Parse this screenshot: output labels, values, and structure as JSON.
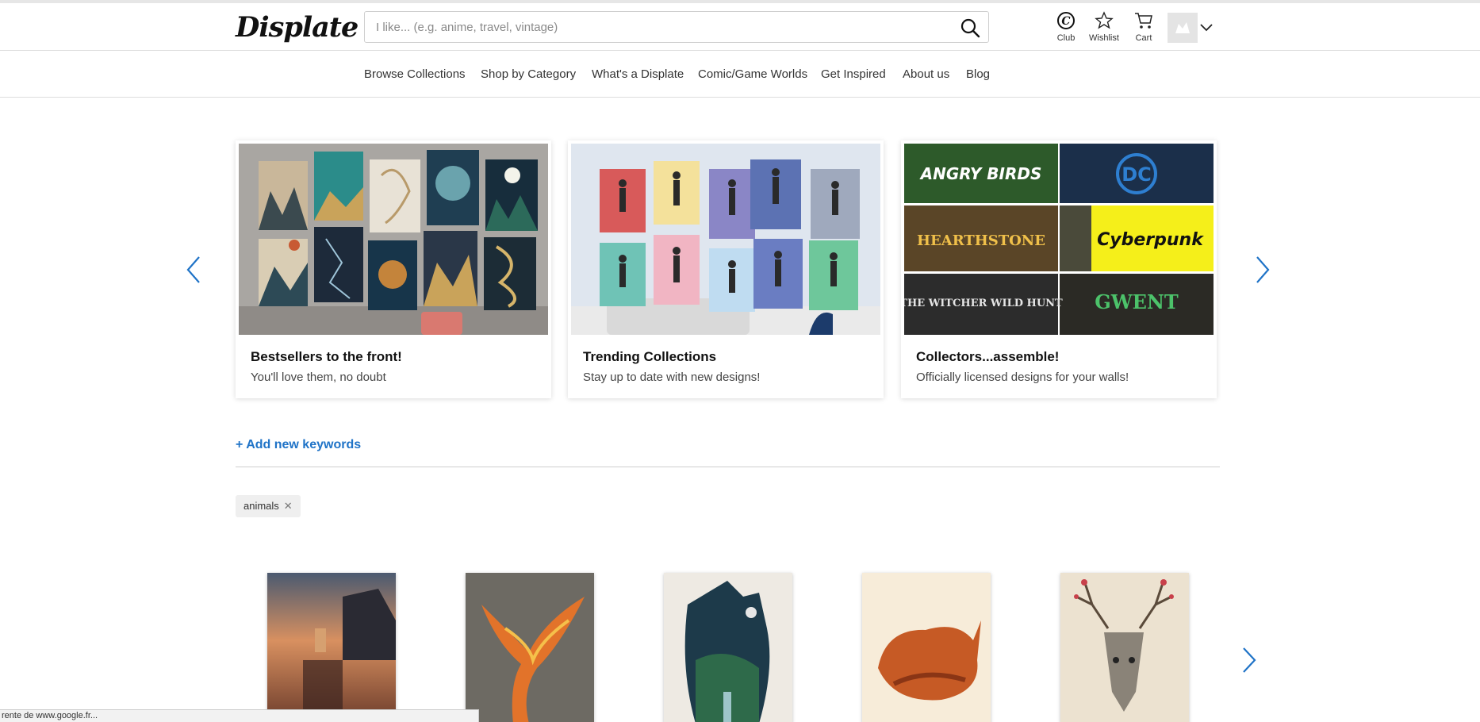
{
  "header": {
    "logo": "Displate",
    "search_placeholder": "I like... (e.g. anime, travel, vintage)",
    "club_label": "Club",
    "wishlist_label": "Wishlist",
    "cart_label": "Cart"
  },
  "nav": {
    "items": [
      "Browse Collections",
      "Shop by Category",
      "What's a Displate",
      "Comic/Game Worlds",
      "Get Inspired",
      "About us",
      "Blog"
    ]
  },
  "carousel": {
    "cards": [
      {
        "title": "Bestsellers to the front!",
        "subtitle": "You'll love them, no doubt"
      },
      {
        "title": "Trending Collections",
        "subtitle": "Stay up to date with new designs!"
      },
      {
        "title": "Collectors...assemble!",
        "subtitle": "Officially licensed designs for your walls!"
      }
    ],
    "brand_tiles": [
      "ANGRY BIRDS",
      "DC",
      "HEARTHSTONE",
      "Cyberpunk",
      "THE WITCHER WILD HUNT",
      "GWENT"
    ]
  },
  "keywords": {
    "add_label": "+ Add new keywords",
    "tags": [
      "animals"
    ]
  },
  "status_bar": "rente de www.google.fr...",
  "colors": {
    "accent": "#1f73c7",
    "text": "#222222"
  }
}
